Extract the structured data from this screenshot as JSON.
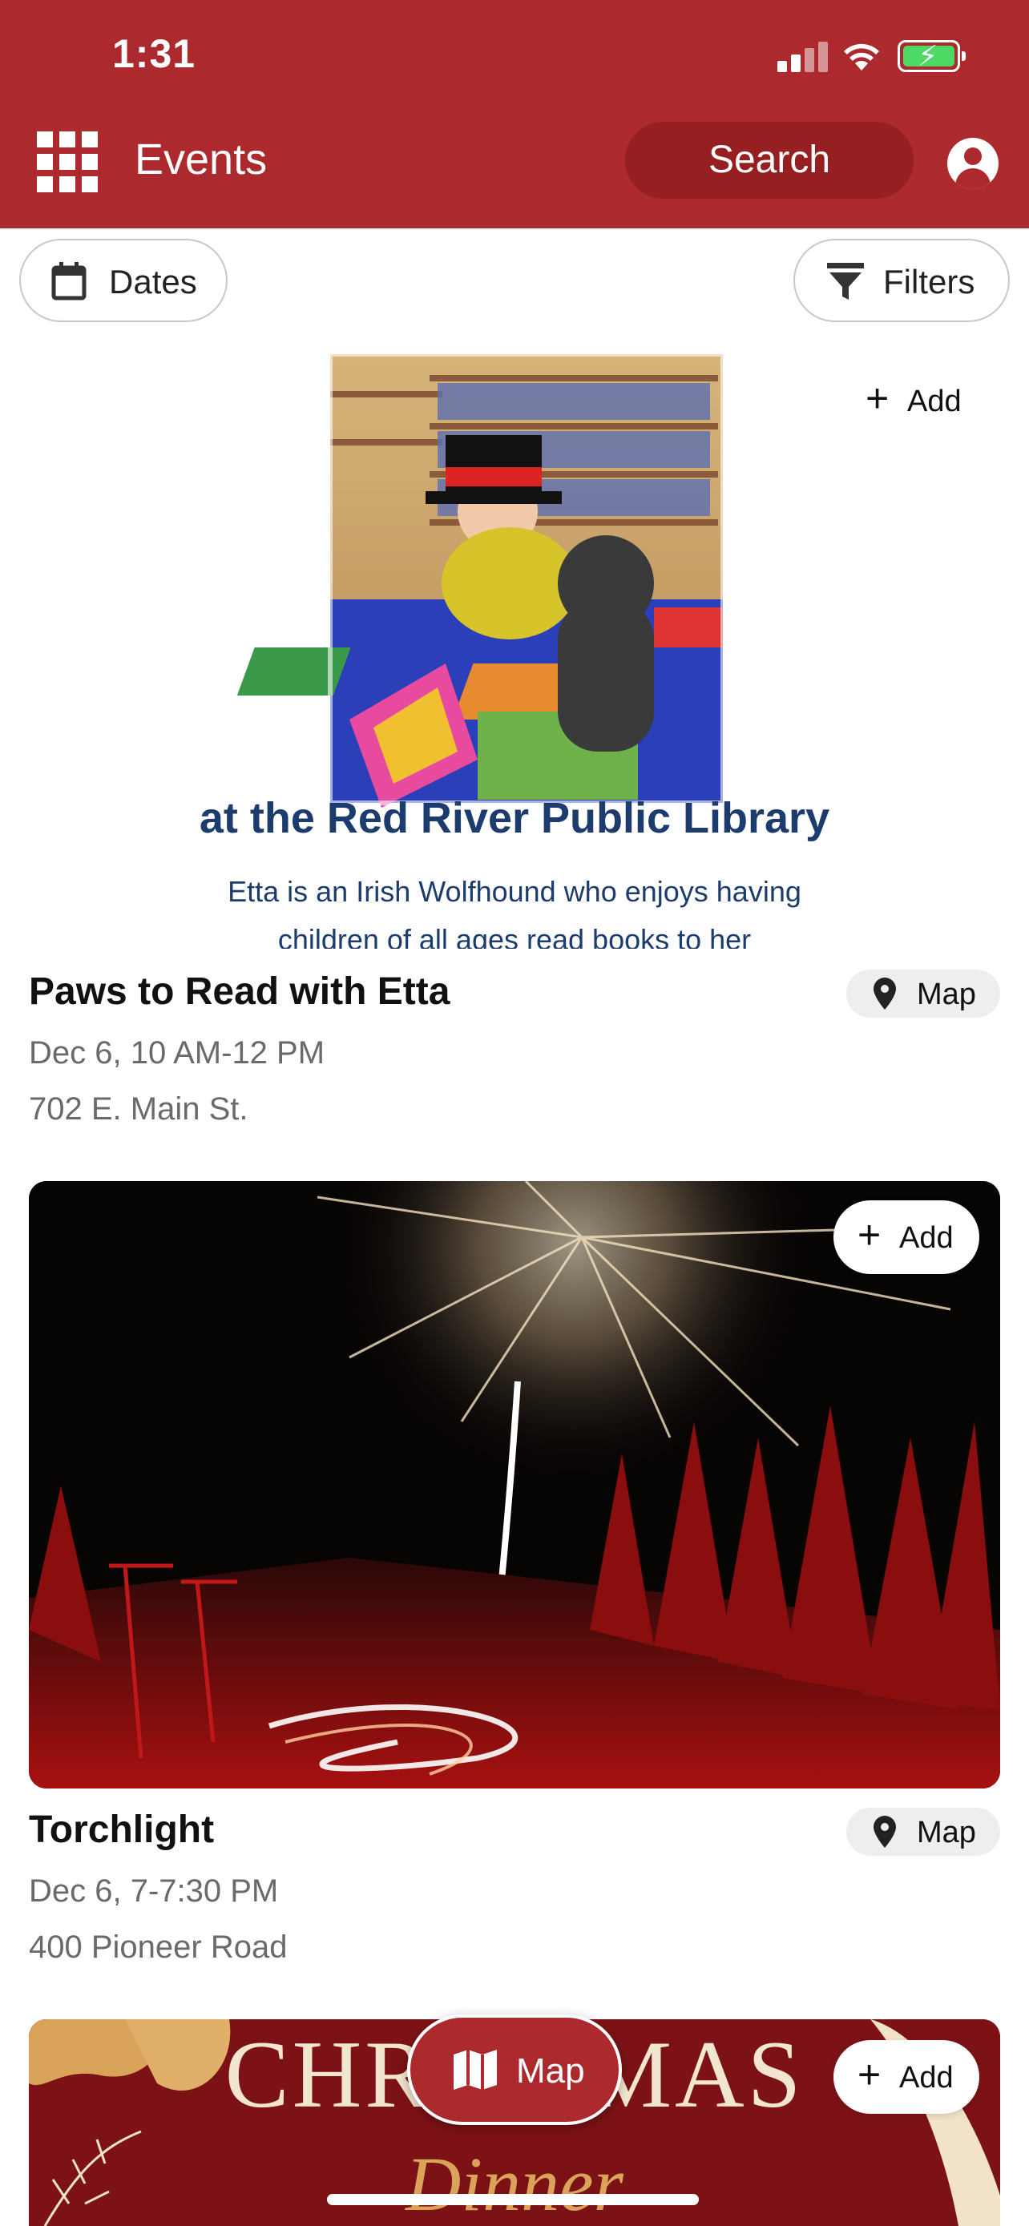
{
  "status": {
    "time": "1:31"
  },
  "header": {
    "title": "Events",
    "search_label": "Search"
  },
  "filters": {
    "dates_label": "Dates",
    "filters_label": "Filters"
  },
  "events": [
    {
      "title": "Paws to Read with Etta",
      "date": "Dec 6, 10 AM-12 PM",
      "address": "702 E. Main St.",
      "add_label": "Add",
      "map_label": "Map",
      "image_caption": "at the Red River Public Library",
      "image_desc_line1": "Etta is an Irish Wolfhound who enjoys having",
      "image_desc_line2": "children of all ages read books to her"
    },
    {
      "title": "Torchlight",
      "date": "Dec 6, 7-7:30 PM",
      "address": "400 Pioneer Road",
      "add_label": "Add",
      "map_label": "Map"
    },
    {
      "add_label": "Add",
      "image_text_1": "CHRISTMAS",
      "image_text_2": "Dinner"
    }
  ],
  "map_button": {
    "label": "Map"
  },
  "colors": {
    "brand": "#ac2a2d",
    "brand_dark": "#961f22",
    "battery": "#4cd964"
  }
}
